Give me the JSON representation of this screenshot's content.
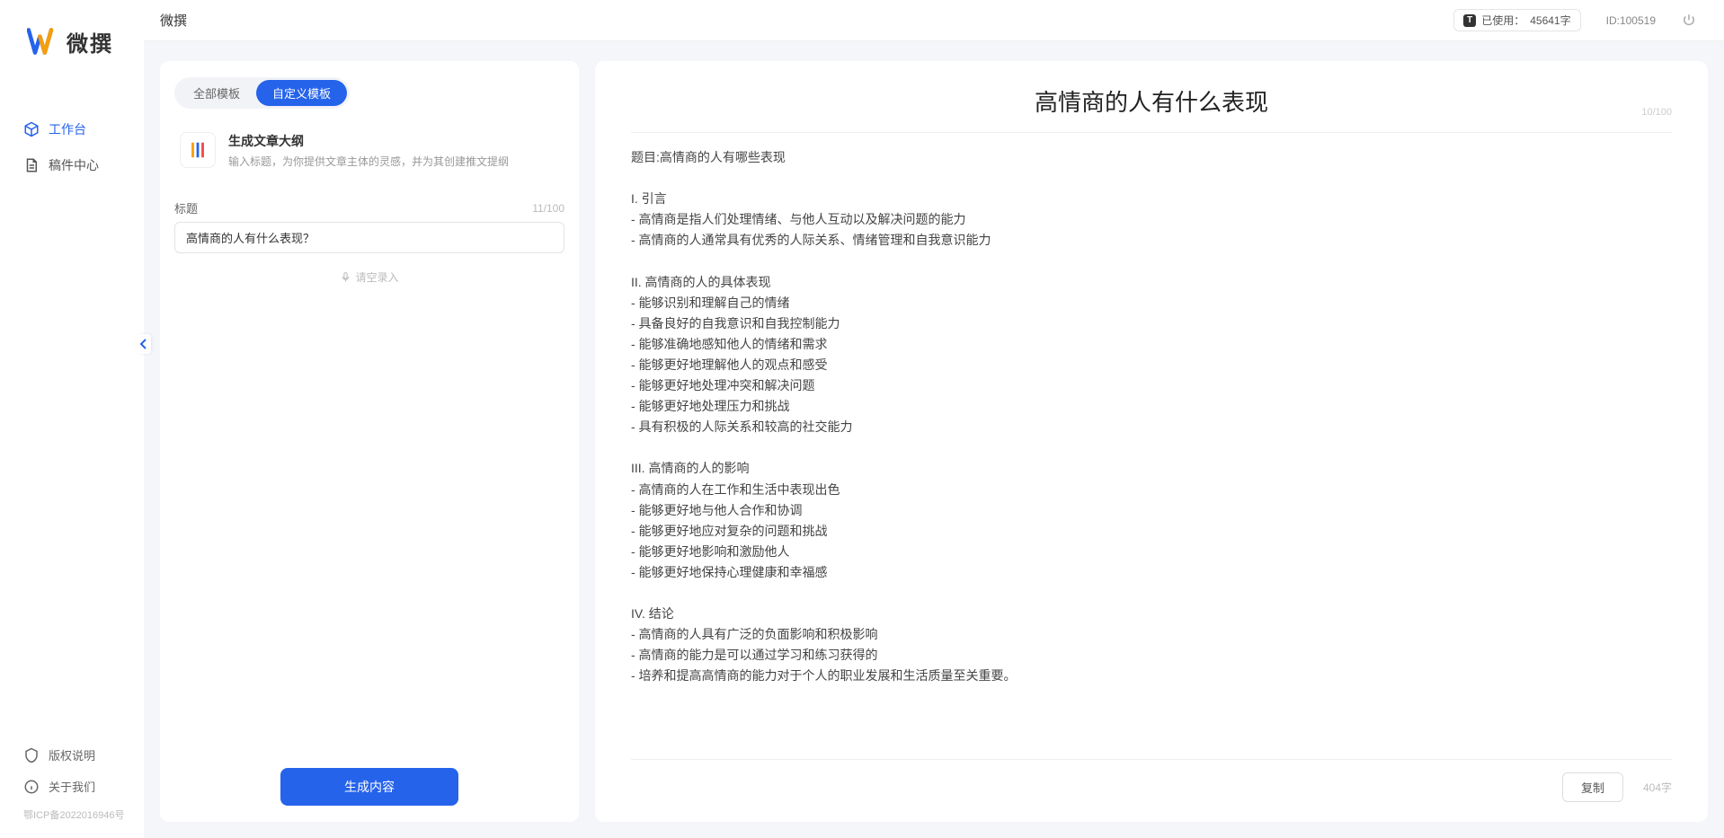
{
  "brand": {
    "name": "微撰"
  },
  "sidebar": {
    "nav": [
      {
        "label": "工作台"
      },
      {
        "label": "稿件中心"
      }
    ],
    "bottom": [
      {
        "label": "版权说明"
      },
      {
        "label": "关于我们"
      }
    ],
    "icp": "鄂ICP备2022016946号"
  },
  "header": {
    "title": "微撰",
    "usage_prefix": "已使用：",
    "usage_value": "45641字",
    "user_id": "ID:100519"
  },
  "leftPanel": {
    "tabs": [
      {
        "label": "全部模板"
      },
      {
        "label": "自定义模板"
      }
    ],
    "template": {
      "title": "生成文章大纲",
      "desc": "输入标题，为你提供文章主体的灵感，并为其创建推文提纲"
    },
    "title_label": "标题",
    "title_count": "11/100",
    "title_value": "高情商的人有什么表现？",
    "voice_label": "请空录入",
    "generate_label": "生成内容"
  },
  "result": {
    "title": "高情商的人有什么表现",
    "title_count": "10/100",
    "body": "题目:高情商的人有哪些表现\n\nI. 引言\n- 高情商是指人们处理情绪、与他人互动以及解决问题的能力\n- 高情商的人通常具有优秀的人际关系、情绪管理和自我意识能力\n\nII. 高情商的人的具体表现\n- 能够识别和理解自己的情绪\n- 具备良好的自我意识和自我控制能力\n- 能够准确地感知他人的情绪和需求\n- 能够更好地理解他人的观点和感受\n- 能够更好地处理冲突和解决问题\n- 能够更好地处理压力和挑战\n- 具有积极的人际关系和较高的社交能力\n\nIII. 高情商的人的影响\n- 高情商的人在工作和生活中表现出色\n- 能够更好地与他人合作和协调\n- 能够更好地应对复杂的问题和挑战\n- 能够更好地影响和激励他人\n- 能够更好地保持心理健康和幸福感\n\nIV. 结论\n- 高情商的人具有广泛的负面影响和积极影响\n- 高情商的能力是可以通过学习和练习获得的\n- 培养和提高高情商的能力对于个人的职业发展和生活质量至关重要。",
    "copy_label": "复制",
    "word_count": "404字"
  }
}
